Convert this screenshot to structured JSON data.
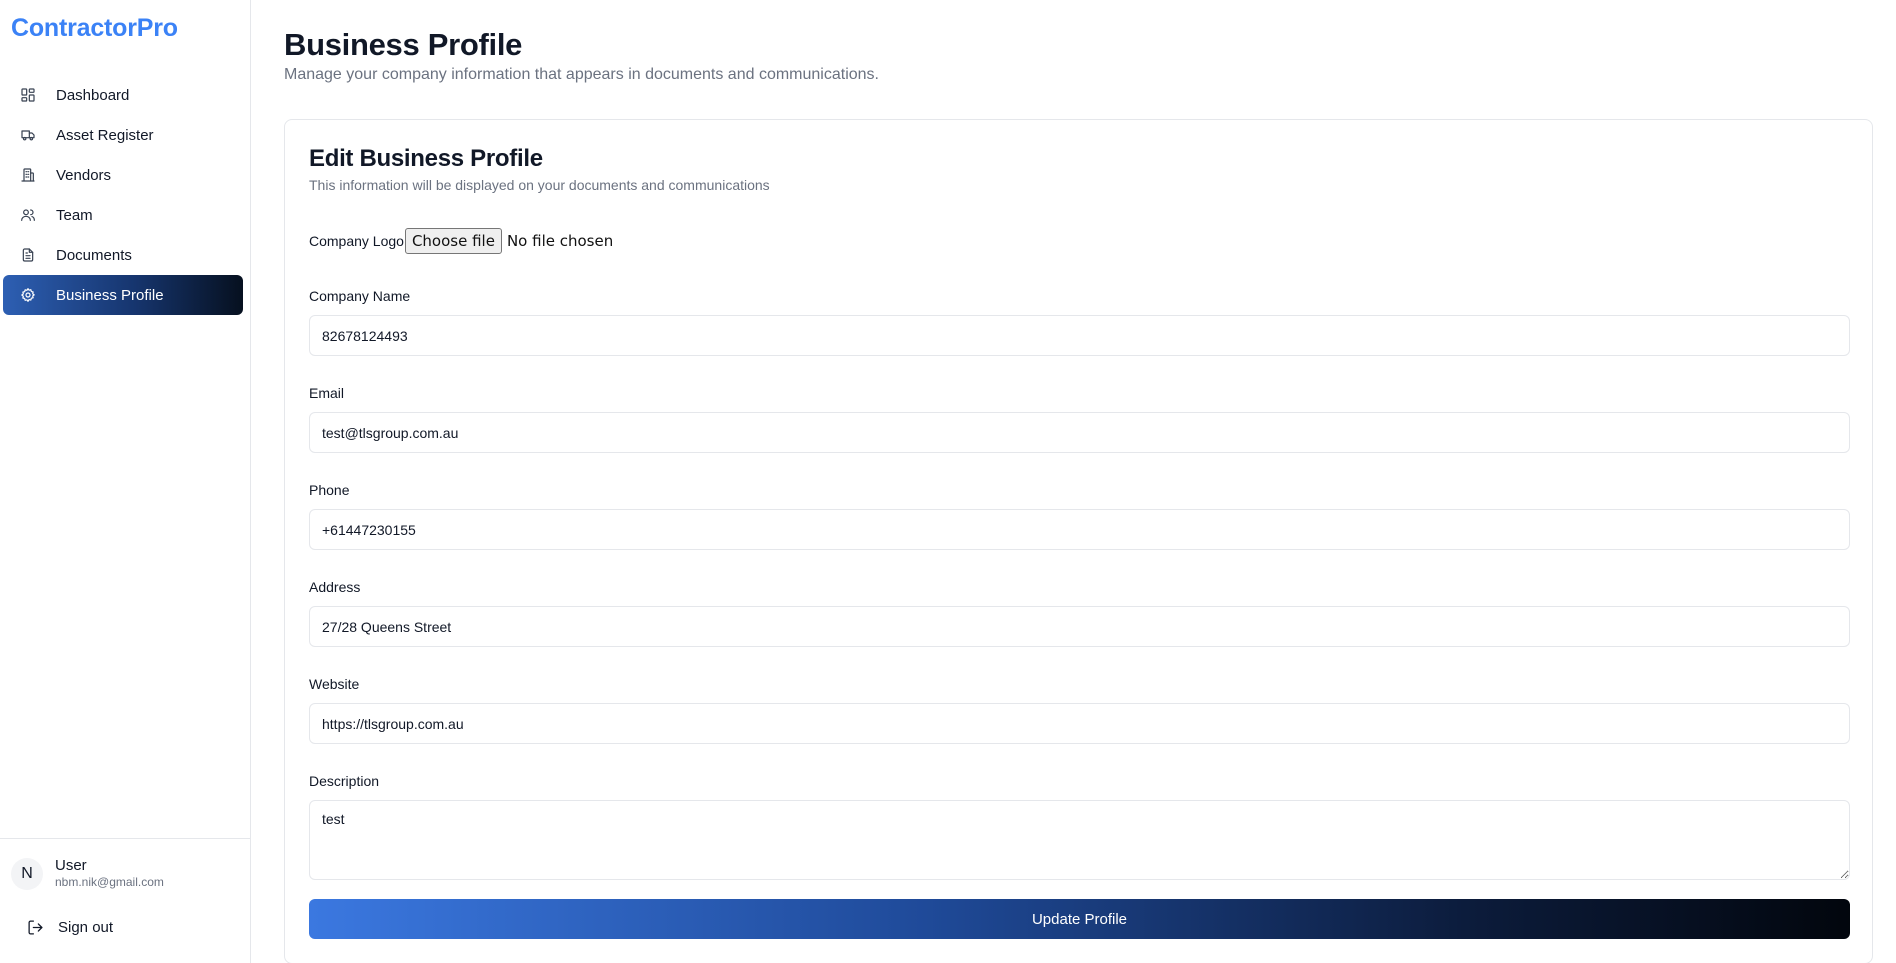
{
  "app": {
    "brand": "ContractorPro"
  },
  "sidebar": {
    "items": [
      {
        "label": "Dashboard",
        "icon": "dashboard-icon",
        "active": false
      },
      {
        "label": "Asset Register",
        "icon": "truck-icon",
        "active": false
      },
      {
        "label": "Vendors",
        "icon": "building-icon",
        "active": false
      },
      {
        "label": "Team",
        "icon": "users-icon",
        "active": false
      },
      {
        "label": "Documents",
        "icon": "file-text-icon",
        "active": false
      },
      {
        "label": "Business Profile",
        "icon": "gear-icon",
        "active": true
      }
    ],
    "user": {
      "initial": "N",
      "name": "User",
      "email": "nbm.nik@gmail.com"
    },
    "signout_label": "Sign out"
  },
  "header": {
    "title": "Business Profile",
    "subtitle": "Manage your company information that appears in documents and communications."
  },
  "form": {
    "title": "Edit Business Profile",
    "description": "This information will be displayed on your documents and communications",
    "logo": {
      "label": "Company Logo",
      "button": "Choose file",
      "status": "No file chosen"
    },
    "fields": {
      "company_name": {
        "label": "Company Name",
        "value": "82678124493"
      },
      "email": {
        "label": "Email",
        "value": "test@tlsgroup.com.au"
      },
      "phone": {
        "label": "Phone",
        "value": "+61447230155"
      },
      "address": {
        "label": "Address",
        "value": "27/28 Queens Street"
      },
      "website": {
        "label": "Website",
        "value": "https://tlsgroup.com.au"
      },
      "description": {
        "label": "Description",
        "value": "test"
      }
    },
    "submit_label": "Update Profile"
  },
  "colors": {
    "brand": "#3b82f6",
    "active_gradient_start": "#2d5fb3",
    "active_gradient_end": "#06101f",
    "border": "#e5e7eb",
    "muted_text": "#6b7280"
  }
}
